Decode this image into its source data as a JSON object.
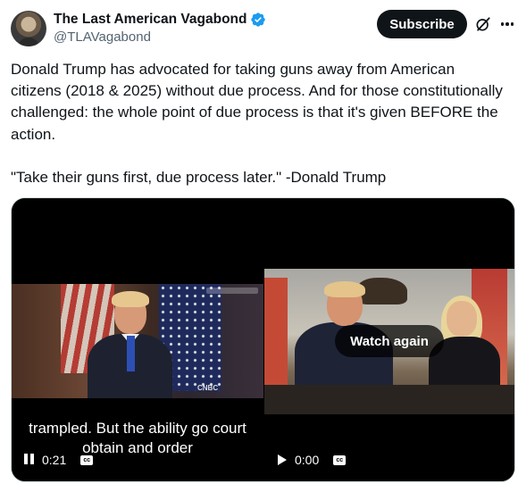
{
  "author": {
    "display_name": "The Last American Vagabond",
    "handle": "@TLAVagabond",
    "verified": true,
    "avatar_icon": "avatar-photo"
  },
  "actions": {
    "subscribe_label": "Subscribe",
    "grok_icon": "grok-icon",
    "more_icon": "more-icon"
  },
  "tweet": {
    "paragraph1": "Donald Trump has advocated for taking guns away from American citizens (2018 & 2025) without due process. And for those constitutionally challenged: the whole point of due process is that it's given BEFORE the action.",
    "paragraph2": "\"Take their guns first, due process later.\" -Donald Trump"
  },
  "videos": [
    {
      "caption": "trampled. But the ability go court obtain and order",
      "state": "playing",
      "time": "0:21",
      "watermark": "CNBC",
      "control_icon": "pause-icon"
    },
    {
      "overlay_label": "Watch again",
      "state": "ended",
      "time": "0:00",
      "control_icon": "play-icon"
    }
  ],
  "colors": {
    "text": "#0f1419",
    "muted": "#536471",
    "verified_blue": "#1d9bf0",
    "button_dark": "#0f1419"
  }
}
